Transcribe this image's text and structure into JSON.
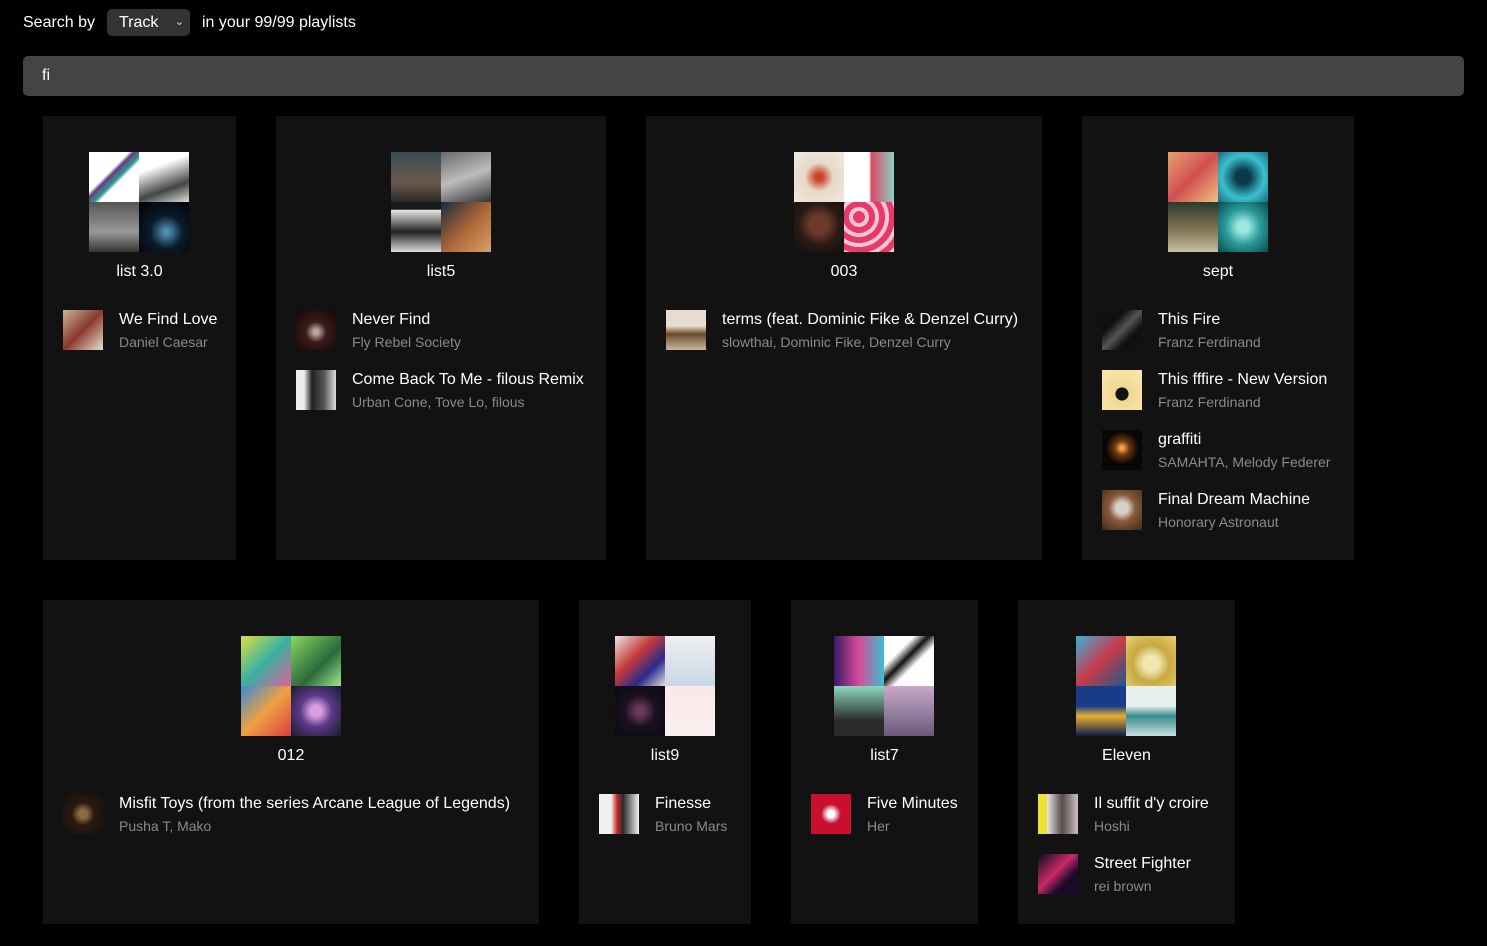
{
  "header": {
    "search_by_label": "Search by",
    "search_type": "Track",
    "search_type_options": [
      "Track"
    ],
    "playlists_count_text": "in your 99/99 playlists"
  },
  "search": {
    "value": "fi"
  },
  "playlists": [
    {
      "name": "list 3.0",
      "tracks": [
        {
          "title": "We Find Love",
          "artist": "Daniel Caesar"
        }
      ]
    },
    {
      "name": "list5",
      "tracks": [
        {
          "title": "Never Find",
          "artist": "Fly Rebel Society"
        },
        {
          "title": "Come Back To Me - filous Remix",
          "artist": "Urban Cone, Tove Lo, filous"
        }
      ]
    },
    {
      "name": "003",
      "tracks": [
        {
          "title": "terms (feat. Dominic Fike & Denzel Curry)",
          "artist": "slowthai, Dominic Fike, Denzel Curry"
        }
      ]
    },
    {
      "name": "sept",
      "tracks": [
        {
          "title": "This Fire",
          "artist": "Franz Ferdinand"
        },
        {
          "title": "This fffire - New Version",
          "artist": "Franz Ferdinand"
        },
        {
          "title": "graffiti",
          "artist": "SAMAHTA, Melody Federer"
        },
        {
          "title": "Final Dream Machine",
          "artist": "Honorary Astronaut"
        }
      ]
    },
    {
      "name": "012",
      "tracks": [
        {
          "title": "Misfit Toys (from the series Arcane League of Legends)",
          "artist": "Pusha T, Mako"
        }
      ]
    },
    {
      "name": "list9",
      "tracks": [
        {
          "title": "Finesse",
          "artist": "Bruno Mars"
        }
      ]
    },
    {
      "name": "list7",
      "tracks": [
        {
          "title": "Five Minutes",
          "artist": "Her"
        }
      ]
    },
    {
      "name": "Eleven",
      "tracks": [
        {
          "title": "Il suffit d'y croire",
          "artist": "Hoshi"
        },
        {
          "title": "Street Fighter",
          "artist": "rei brown"
        }
      ]
    }
  ],
  "colors": {
    "background": "#000000",
    "card": "#121212",
    "search_bar": "#444444",
    "select": "#333333",
    "secondary_text": "#8a8a8a"
  },
  "icons": {
    "select_chevron": "chevron-down-icon"
  }
}
